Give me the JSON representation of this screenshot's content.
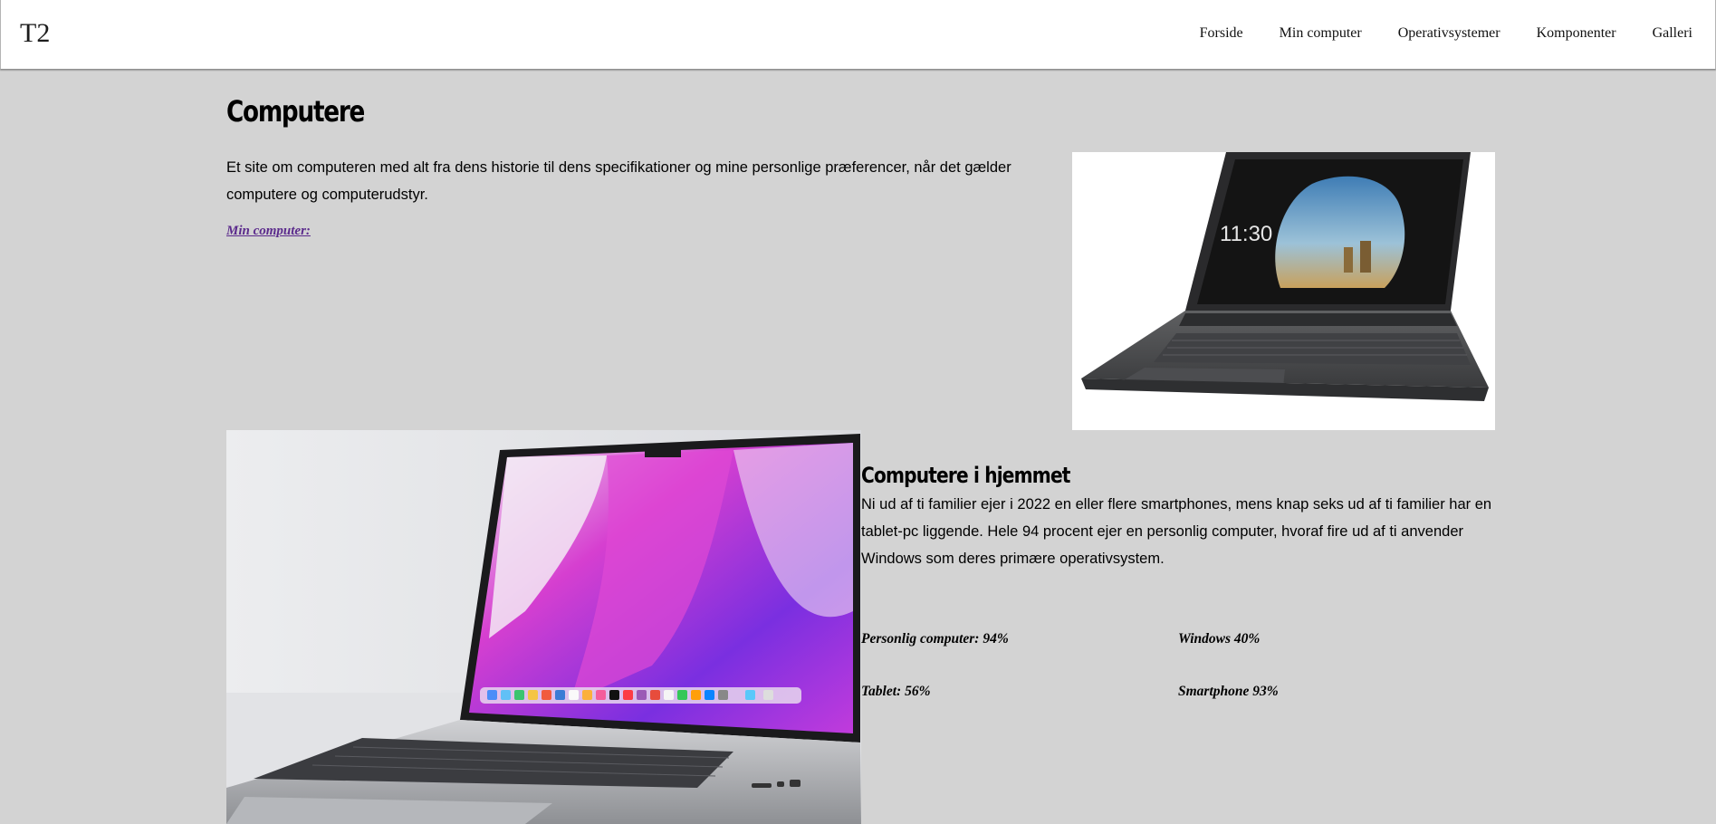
{
  "header": {
    "logo": "T2",
    "nav": [
      "Forside",
      "Min computer",
      "Operativsystemer",
      "Komponenter",
      "Galleri"
    ]
  },
  "main": {
    "title": "Computere",
    "intro": "Et site om computeren med alt fra dens historie til dens specifikationer og mine personlige præferencer, når det gælder computere og computerudstyr.",
    "link": "Min computer:",
    "laptop_clock": "11:30"
  },
  "home": {
    "heading": "Computere i hjemmet",
    "text": "Ni ud af ti familier ejer i 2022 en eller flere smartphones, mens knap seks ud af ti familier har en tablet-pc liggende. Hele 94 procent ejer en personlig computer, hvoraf fire ud af ti anvender Windows som deres primære operativsystem.",
    "stats": {
      "pc": "Personlig computer: 94%",
      "windows": "Windows 40%",
      "tablet": "Tablet: 56%",
      "smartphone": "Smartphone 93%"
    }
  },
  "colors": {
    "background": "#d3d3d3",
    "header": "#ffffff",
    "link": "#5b2a8c"
  }
}
